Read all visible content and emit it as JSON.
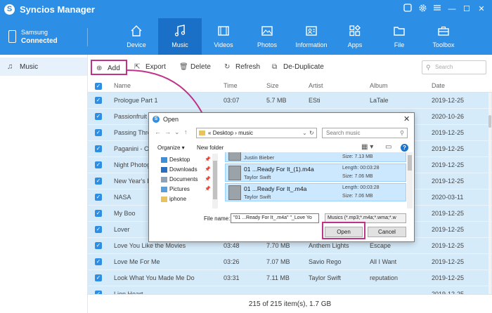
{
  "app": {
    "title": "Syncios Manager",
    "logo_glyph": "S"
  },
  "window_controls": {
    "minimize": "—",
    "maximize": "☐",
    "close": "✕"
  },
  "device": {
    "name": "Samsung",
    "status": "Connected"
  },
  "nav": {
    "tabs": [
      {
        "label": "Device",
        "icon": "home-icon"
      },
      {
        "label": "Music",
        "icon": "music-note-icon",
        "active": true
      },
      {
        "label": "Videos",
        "icon": "film-icon"
      },
      {
        "label": "Photos",
        "icon": "image-icon"
      },
      {
        "label": "Information",
        "icon": "contact-card-icon"
      },
      {
        "label": "Apps",
        "icon": "apps-icon"
      },
      {
        "label": "File",
        "icon": "folder-icon"
      },
      {
        "label": "Toolbox",
        "icon": "toolbox-icon"
      }
    ]
  },
  "sidebar": {
    "items": [
      {
        "label": "Music",
        "icon": "music-note-icon"
      }
    ]
  },
  "toolbar": {
    "add": "Add",
    "export": "Export",
    "delete": "Delete",
    "refresh": "Refresh",
    "dedupe": "De-Duplicate",
    "search_placeholder": "Search"
  },
  "table": {
    "columns": [
      "Name",
      "Time",
      "Size",
      "Artist",
      "Album",
      "Date"
    ],
    "rows": [
      [
        "Prologue Part 1",
        "03:07",
        "5.7 MB",
        "ESti",
        "LaTale",
        "2019-12-25"
      ],
      [
        "Passionfruit",
        "",
        "",
        "",
        "",
        "2020-10-26"
      ],
      [
        "Passing Throu",
        "",
        "",
        "",
        "",
        "2019-12-25"
      ],
      [
        "Paganini - Cer",
        "",
        "",
        "",
        "",
        "2019-12-25"
      ],
      [
        "Night Photogr",
        "",
        "",
        "",
        "",
        "2019-12-25"
      ],
      [
        "New Year's Da",
        "",
        "",
        "",
        "",
        "2019-12-25"
      ],
      [
        "NASA",
        "",
        "",
        "",
        "",
        "2020-03-11"
      ],
      [
        "My Boo",
        "",
        "",
        "",
        "",
        "2019-12-25"
      ],
      [
        "Lover",
        "",
        "",
        "",
        "",
        "2019-12-25"
      ],
      [
        "Love You Like the Movies",
        "03:48",
        "7.70 MB",
        "Anthem Lights",
        "Escape",
        "2019-12-25"
      ],
      [
        "Love Me For Me",
        "03:26",
        "7.07 MB",
        "Savio Rego",
        "All I Want",
        "2019-12-25"
      ],
      [
        "Look What You Made Me Do",
        "03:31",
        "7.11 MB",
        "Taylor Swift",
        "reputation",
        "2019-12-25"
      ],
      [
        "Lion Heart",
        "",
        "",
        "",
        "",
        "2019-12-25"
      ]
    ]
  },
  "status": {
    "text": "215 of 215 item(s), 1.7 GB"
  },
  "dialog": {
    "title": "Open",
    "close": "✕",
    "nav_back": "←",
    "nav_forward": "→",
    "nav_recent": "⌄",
    "nav_up": "↑",
    "address_prefix": "«",
    "address_path": "Desktop › music",
    "address_chevron": "⌄",
    "address_refresh": "↻",
    "search_placeholder": "Search music",
    "search_icon": "⚲",
    "organize": "Organize ▾",
    "new_folder": "New folder",
    "view_glyph": "▦ ▾",
    "pane_glyph": "▭",
    "help": "?",
    "tree": [
      {
        "label": "Desktop",
        "icon": "desktop-folder-icon"
      },
      {
        "label": "Downloads",
        "icon": "downloads-folder-icon"
      },
      {
        "label": "Documents",
        "icon": "documents-folder-icon"
      },
      {
        "label": "Pictures",
        "icon": "pictures-folder-icon"
      },
      {
        "label": "iphone",
        "icon": "folder-icon"
      }
    ],
    "files": [
      {
        "name": "",
        "artist": "Justin Bieber",
        "length": "",
        "size": "Size: 7.13 MB"
      },
      {
        "name": "01 ...Ready For It_(1).m4a",
        "artist": "Taylor Swift",
        "length": "Length: 00:03:28",
        "size": "Size: 7.06 MB"
      },
      {
        "name": "01 ...Ready For It_.m4a",
        "artist": "Taylor Swift",
        "length": "Length: 00:03:28",
        "size": "Size: 7.06 MB"
      }
    ],
    "filename_label": "File name:",
    "filename_value": "\"01 ...Ready For It_.m4a\" \"_Love Yo",
    "filter_value": "Musics (*.mp3;*.m4a;*.wma;*.w",
    "open_label": "Open",
    "cancel_label": "Cancel"
  },
  "colors": {
    "brand": "#2c8ee4",
    "active_tab": "#1a6fc6",
    "row_bg": "#d6ebfa",
    "highlight": "#c0338a"
  }
}
